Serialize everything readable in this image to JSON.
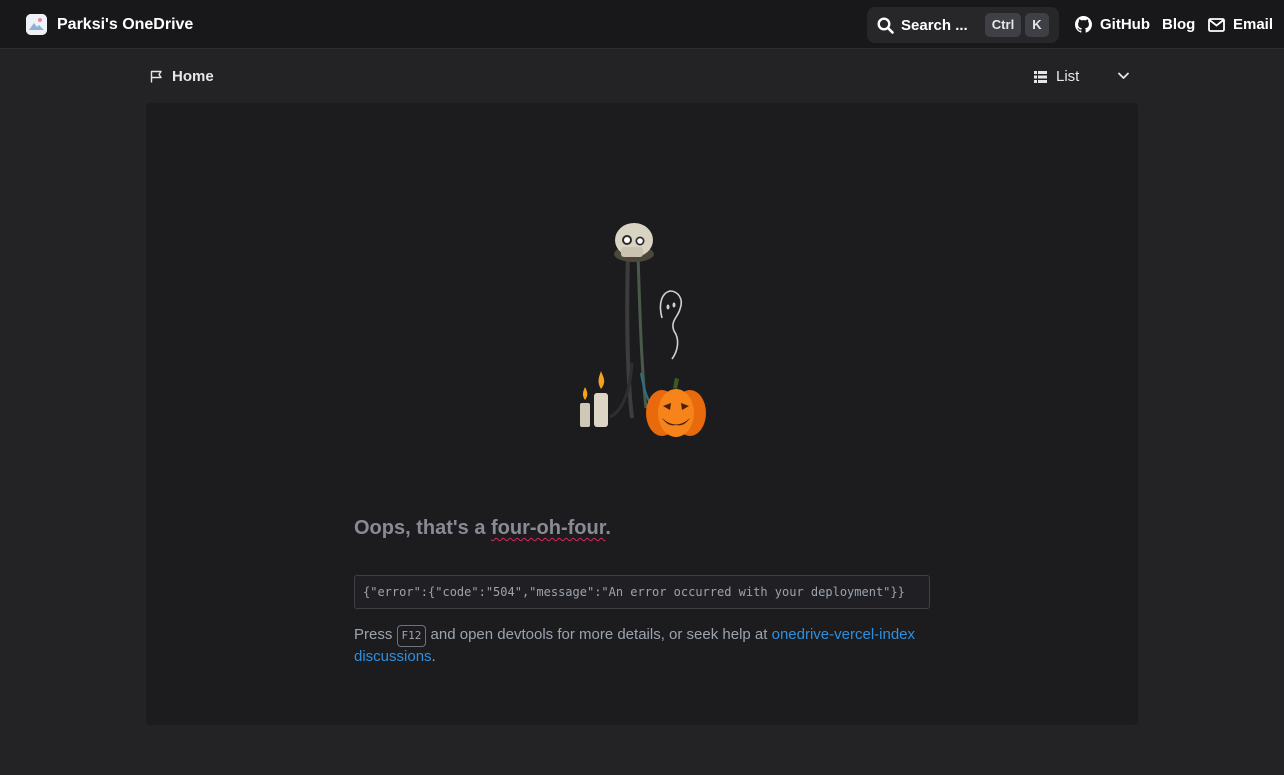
{
  "header": {
    "site_title": "Parksi's OneDrive",
    "search": {
      "label": "Search ...",
      "shortcut_modifier": "Ctrl",
      "shortcut_key": "K"
    },
    "links": [
      {
        "label": "GitHub",
        "icon": "github-icon"
      },
      {
        "label": "Blog"
      },
      {
        "label": "Email",
        "icon": "mail-icon"
      }
    ]
  },
  "breadcrumb": {
    "home_label": "Home",
    "icon": "flag-icon"
  },
  "layout_switcher": {
    "selected": "List",
    "icon": "list-grid-icon"
  },
  "error_page": {
    "headline_prefix": "Oops, that's a ",
    "headline_emphasis": "four-oh-four",
    "headline_suffix": ".",
    "error_json": "{\"error\":{\"code\":\"504\",\"message\":\"An error occurred with your deployment\"}}",
    "help_prefix": "Press ",
    "help_key": "F12",
    "help_middle": " and open devtools for more details, or seek help at ",
    "help_link": "onedrive-vercel-index discussions",
    "help_suffix": "."
  },
  "colors": {
    "link": "#2f8fde",
    "pumpkin": "#f07f15",
    "background": "#232326"
  }
}
